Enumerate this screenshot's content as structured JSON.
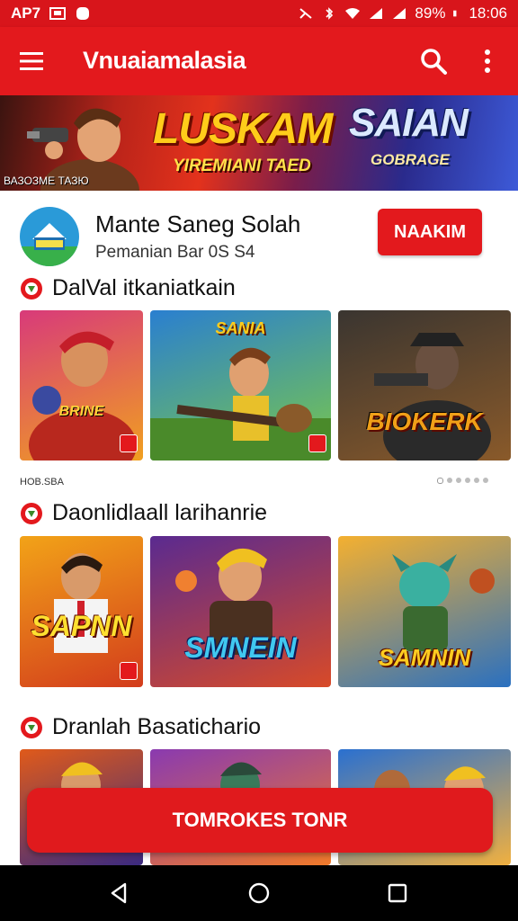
{
  "status_bar": {
    "carrier": "AP7",
    "battery_percent": "89%",
    "time": "18:06"
  },
  "app_bar": {
    "title": "Vnuaiamalasia",
    "menu_icon": "hamburger-menu-icon",
    "search_icon": "search-icon",
    "more_icon": "more-vert-icon"
  },
  "banner": {
    "headline_left": "LUSKAM",
    "headline_right": "SAIAN",
    "subline_left": "YIREMIANI TAED",
    "subline_right": "GOBRAGE",
    "caption": "ВАЗОЗМЕ ТАЗЮ"
  },
  "app_card": {
    "name": "Mante Saneg Solah",
    "subtitle": "Pemanian Bar 0S S4",
    "install_label": "NAAKIM"
  },
  "sections": [
    {
      "title": "DalVal itkaniatkain",
      "tiles": [
        {
          "label": "BRINE",
          "colors": [
            "#d83a7a",
            "#f0a020"
          ]
        },
        {
          "label": "SANIA",
          "colors": [
            "#2a7fd0",
            "#7ac84a"
          ]
        },
        {
          "label": "BIOKERK",
          "colors": [
            "#3a3530",
            "#8a5a2a"
          ]
        }
      ]
    },
    {
      "title": "Daonlidlaall larihanrie",
      "tiles": [
        {
          "label": "SAPNN",
          "colors": [
            "#f2a318",
            "#d33c1c"
          ]
        },
        {
          "label": "SMNEIN",
          "colors": [
            "#5a2a90",
            "#d84a28"
          ]
        },
        {
          "label": "SAMNIN",
          "colors": [
            "#f4b030",
            "#2a70c0"
          ]
        }
      ]
    },
    {
      "title": "Dranlah Basatichario",
      "tiles": [
        {
          "label": "",
          "colors": [
            "#e05a1a",
            "#3a2a80"
          ]
        },
        {
          "label": "",
          "colors": [
            "#8a3ab0",
            "#f07a2a"
          ]
        },
        {
          "label": "",
          "colors": [
            "#2a70d0",
            "#f0b040"
          ]
        }
      ]
    }
  ],
  "small_label": "НОВ.SBA",
  "carousel": {
    "dot_count": 6,
    "active_index": 0
  },
  "cta": {
    "label": "TOMROKES TONR"
  },
  "nav_bar": {
    "back_icon": "back-triangle-icon",
    "home_icon": "home-circle-icon",
    "recents_icon": "recents-square-icon"
  },
  "colors": {
    "brand_red": "#e3191d",
    "status_red": "#d8151b"
  }
}
